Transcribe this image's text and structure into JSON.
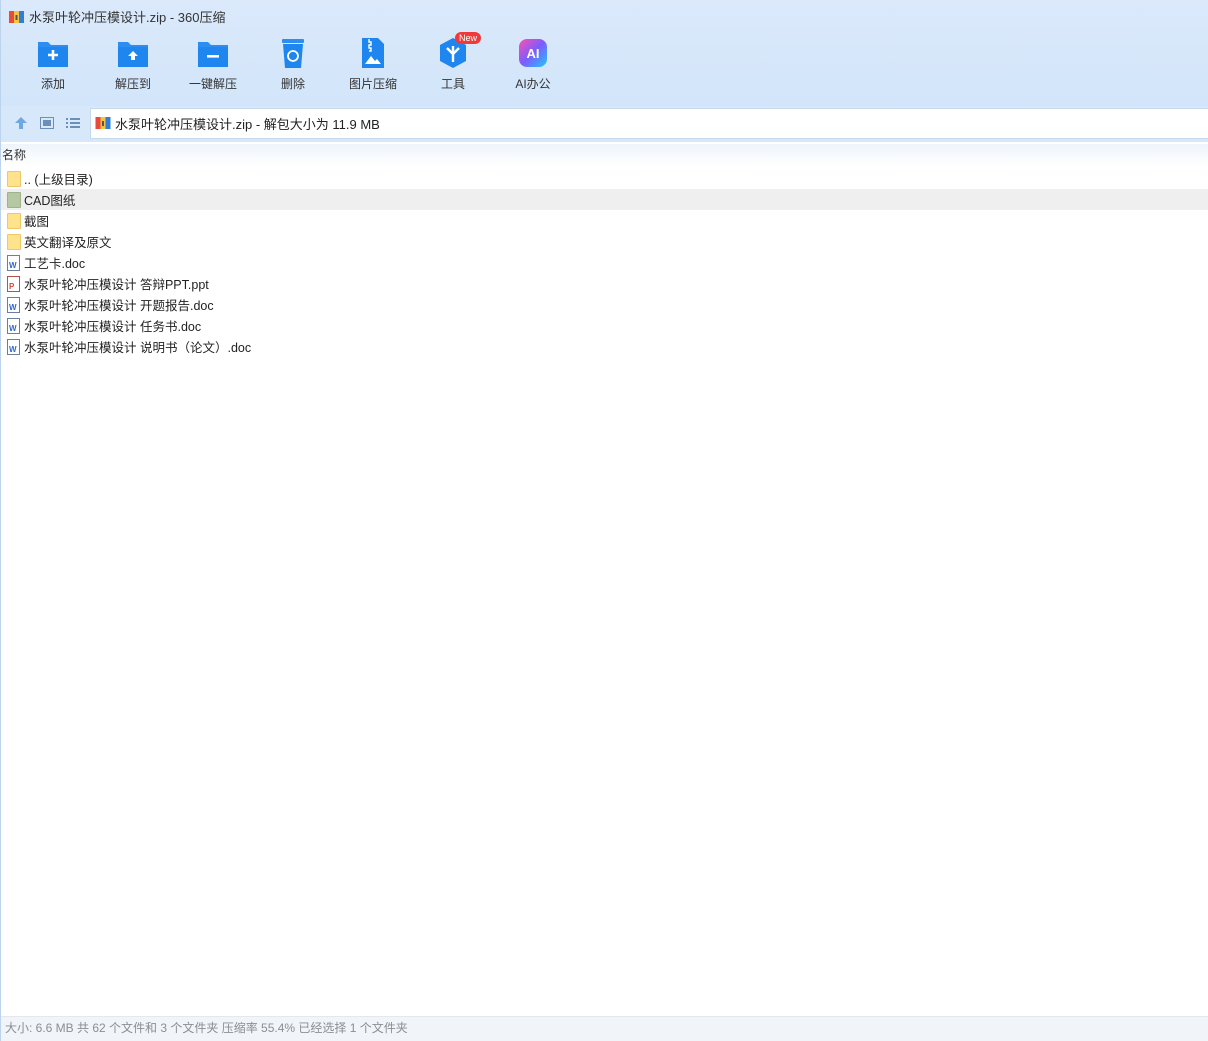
{
  "window": {
    "title": "水泵叶轮冲压模设计.zip - 360压缩"
  },
  "toolbar": {
    "items": [
      {
        "label": "添加",
        "icon": "add-folder-icon"
      },
      {
        "label": "解压到",
        "icon": "extract-to-icon"
      },
      {
        "label": "一键解压",
        "icon": "one-click-extract-icon"
      },
      {
        "label": "删除",
        "icon": "delete-icon"
      },
      {
        "label": "图片压缩",
        "icon": "image-compress-icon"
      },
      {
        "label": "工具",
        "icon": "tools-icon",
        "badge": "New"
      },
      {
        "label": "AI办公",
        "icon": "ai-office-icon"
      }
    ]
  },
  "address": {
    "text": "水泵叶轮冲压模设计.zip - 解包大小为 11.9 MB"
  },
  "list": {
    "column_name": "名称",
    "rows": [
      {
        "name": ".. (上级目录)",
        "type": "folder"
      },
      {
        "name": "CAD图纸",
        "type": "folder",
        "selected": true
      },
      {
        "name": "截图",
        "type": "folder"
      },
      {
        "name": "英文翻译及原文",
        "type": "folder"
      },
      {
        "name": "工艺卡.doc",
        "type": "doc"
      },
      {
        "name": "水泵叶轮冲压模设计 答辩PPT.ppt",
        "type": "ppt"
      },
      {
        "name": "水泵叶轮冲压模设计 开题报告.doc",
        "type": "doc"
      },
      {
        "name": "水泵叶轮冲压模设计 任务书.doc",
        "type": "doc"
      },
      {
        "name": "水泵叶轮冲压模设计 说明书（论文）.doc",
        "type": "doc"
      }
    ]
  },
  "status": {
    "text": "大小: 6.6 MB 共 62 个文件和 3 个文件夹 压缩率 55.4% 已经选择 1 个文件夹"
  },
  "colors": {
    "accent": "#1e8cf0",
    "toolbar_bg": "#d7e8fb",
    "badge": "#f03a3a"
  }
}
